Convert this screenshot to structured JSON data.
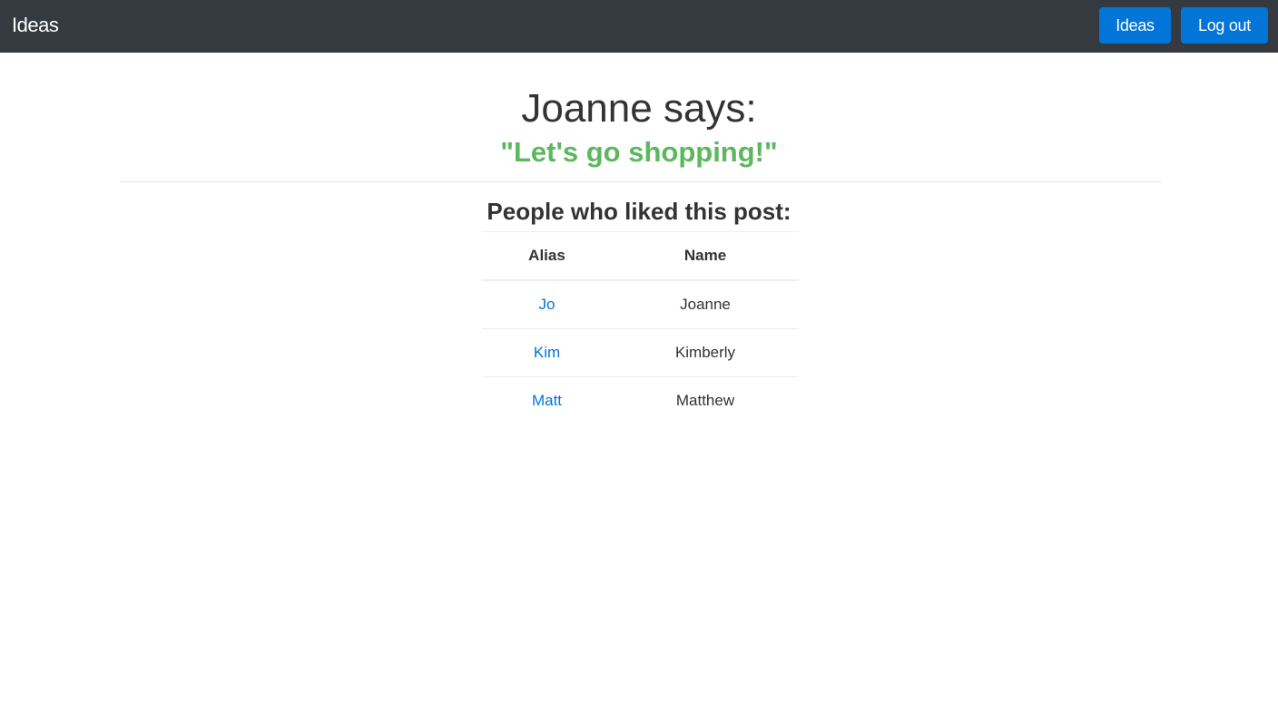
{
  "navbar": {
    "brand": "Ideas",
    "ideas_button": "Ideas",
    "logout_button": "Log out"
  },
  "post": {
    "author_line": "Joanne says:",
    "quote": "\"Let's go shopping!\""
  },
  "likes": {
    "heading": "People who liked this post:",
    "columns": [
      "Alias",
      "Name"
    ],
    "rows": [
      {
        "alias": "Jo",
        "name": "Joanne"
      },
      {
        "alias": "Kim",
        "name": "Kimberly"
      },
      {
        "alias": "Matt",
        "name": "Matthew"
      }
    ]
  },
  "colors": {
    "navbar_bg": "#343a40",
    "button_primary": "#0275d8",
    "quote_green": "#5cb85c",
    "link_blue": "#0275d8"
  }
}
